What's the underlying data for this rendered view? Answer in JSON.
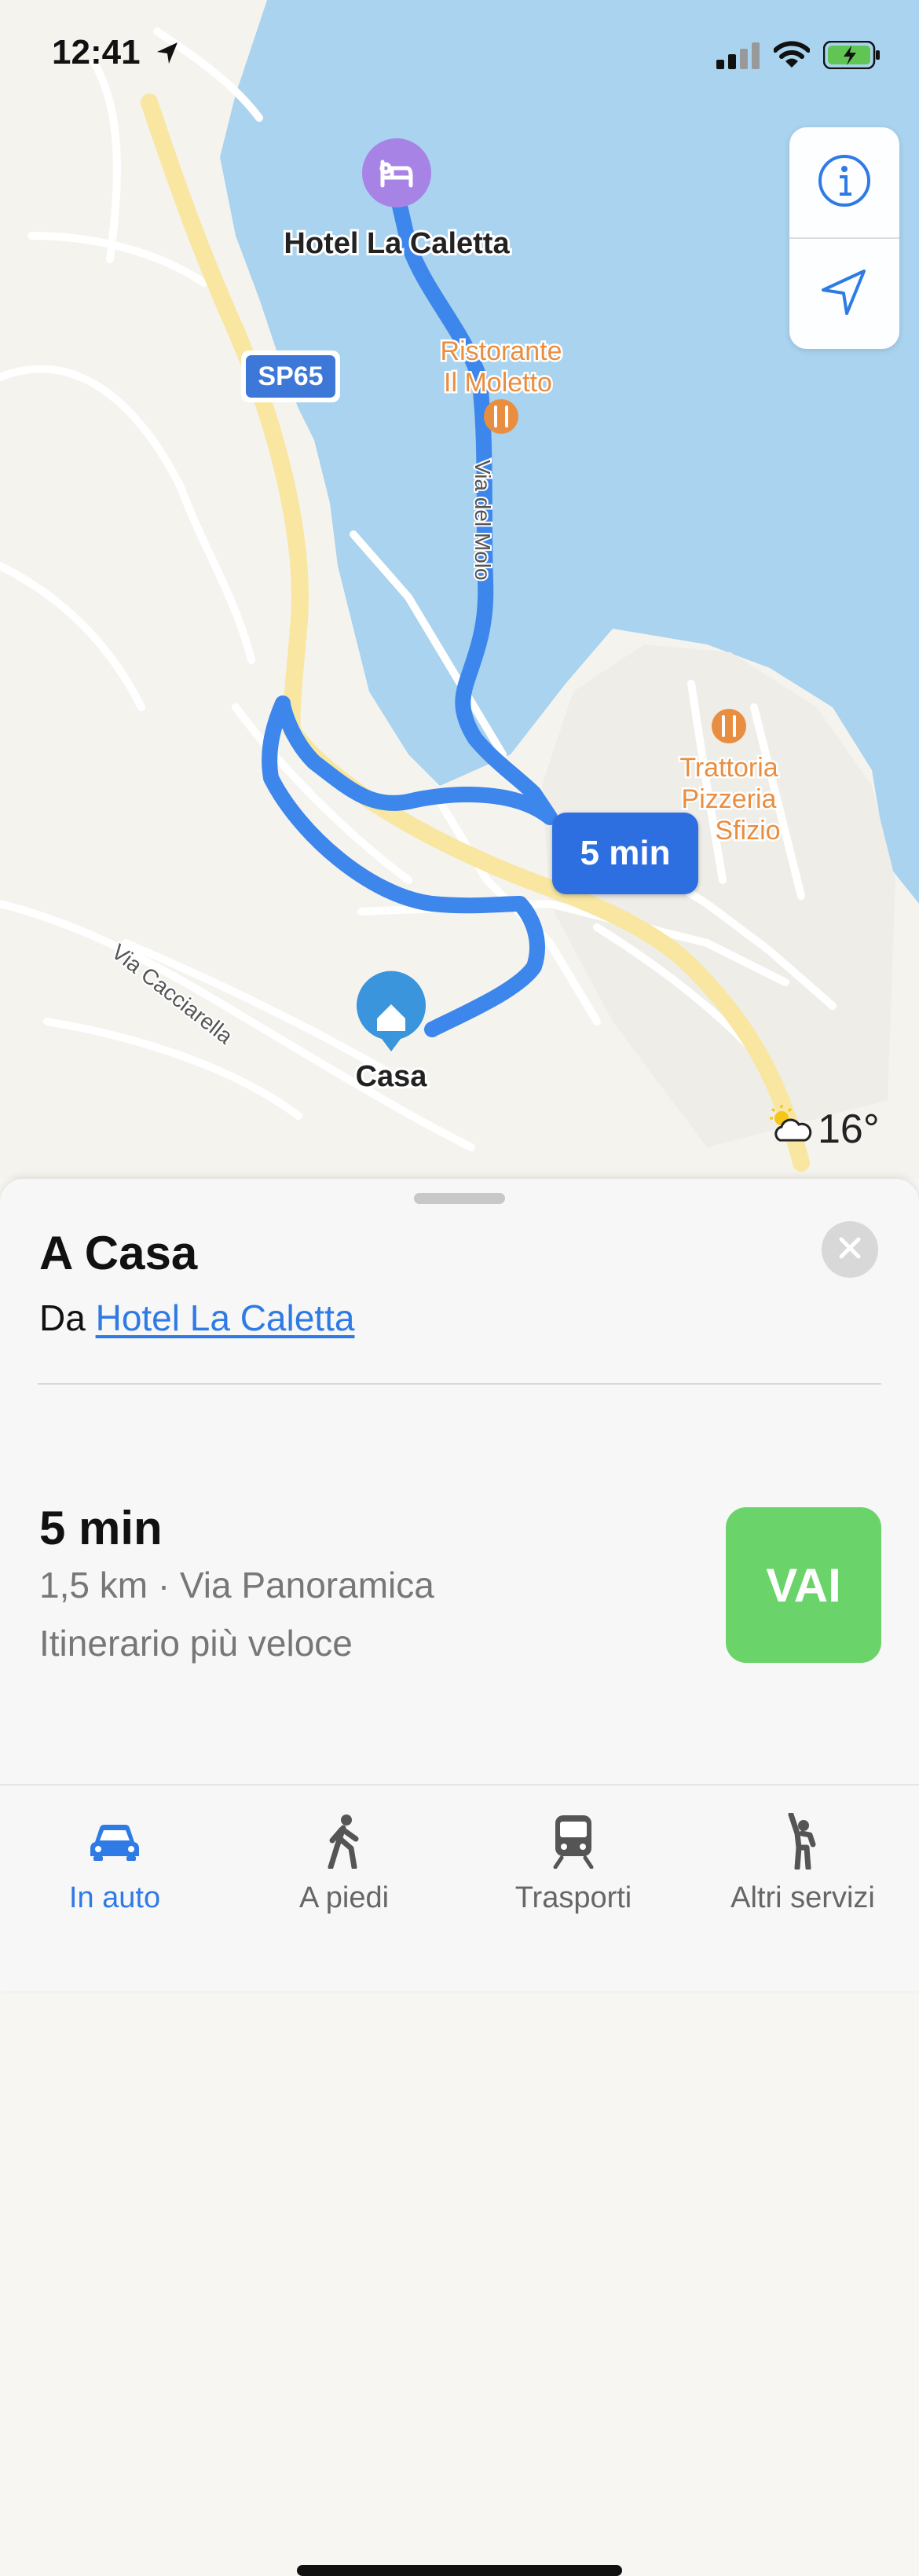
{
  "status_bar": {
    "time": "12:41"
  },
  "map": {
    "hotel_label": "Hotel La Caletta",
    "road_badge": "SP65",
    "restaurant_line1": "Ristorante",
    "restaurant_line2": "Il Moletto",
    "street_molo": "Via del Molo",
    "trattoria_line1": "Trattoria",
    "trattoria_line2": "Pizzeria",
    "trattoria_line3": "Sfizio",
    "street_cacciarella": "Via Cacciarella",
    "home_label": "Casa",
    "eta_badge": "5 min",
    "temperature": "16°",
    "colors": {
      "sea": "#a9d3ee",
      "land": "#f5f3ee",
      "route": "#3d86ec",
      "main_road": "#f8e6a1",
      "poi_orange": "#e98e41",
      "hotel_purple": "#a883e6",
      "home_blue": "#3a95dd"
    }
  },
  "map_controls": {
    "info_icon": "info-icon",
    "location_icon": "location-arrow-icon"
  },
  "sheet": {
    "title": "A Casa",
    "from_prefix": "Da",
    "from_link": "Hotel La Caletta",
    "eta": "5 min",
    "details": "1,5 km · Via Panoramica",
    "route_type": "Itinerario più veloce",
    "go_label": "VAI",
    "go_color": "#6ad36a"
  },
  "tabs": [
    {
      "label": "In auto",
      "icon": "car-icon",
      "active": true
    },
    {
      "label": "A piedi",
      "icon": "walk-icon",
      "active": false
    },
    {
      "label": "Trasporti",
      "icon": "train-icon",
      "active": false
    },
    {
      "label": "Altri servizi",
      "icon": "hail-icon",
      "active": false
    }
  ]
}
